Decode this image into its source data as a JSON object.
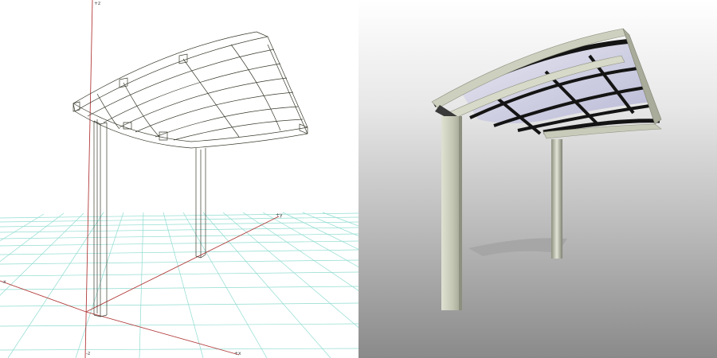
{
  "viewports": {
    "wireframe": {
      "mode": "wireframe",
      "axis_labels": {
        "z_top": "+z",
        "y_pos": "+y",
        "x_neg": "-x",
        "z_bottom": "-z",
        "x_pos": "+x"
      },
      "colors": {
        "grid": "#7fd3c8",
        "axis": "#b23a3a",
        "wire": "#3a3a2e"
      }
    },
    "render": {
      "mode": "shaded",
      "colors": {
        "frame": "#c5c8b6",
        "beam": "#111111",
        "glass": "#c9c9e0",
        "shadow": "#9c9c9c"
      }
    }
  },
  "model": {
    "object": "carport",
    "posts": 2,
    "roof_panel_grid": "4x3"
  }
}
